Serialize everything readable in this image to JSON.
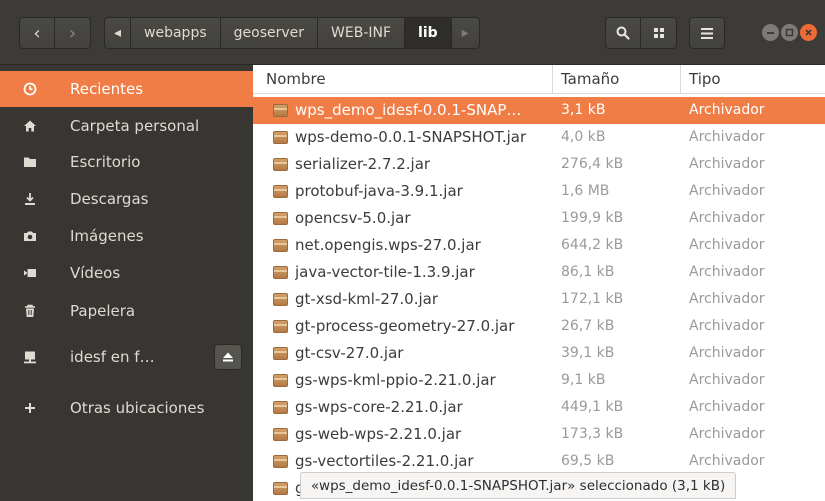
{
  "header": {
    "back_icon": "‹",
    "forward_icon": "›",
    "crumb_left_icon": "◂",
    "crumb_right_icon": "▸",
    "breadcrumbs": [
      "webapps",
      "geoserver",
      "WEB-INF",
      "lib"
    ],
    "active_crumb": "lib"
  },
  "sidebar": {
    "items": [
      {
        "label": "Recientes",
        "icon": "clock-icon"
      },
      {
        "label": "Carpeta personal",
        "icon": "home-icon"
      },
      {
        "label": "Escritorio",
        "icon": "folder-icon"
      },
      {
        "label": "Descargas",
        "icon": "download-icon"
      },
      {
        "label": "Imágenes",
        "icon": "camera-icon"
      },
      {
        "label": "Vídeos",
        "icon": "video-icon"
      },
      {
        "label": "Papelera",
        "icon": "trash-icon"
      },
      {
        "label": "idesf en f…",
        "icon": "network-drive-icon"
      },
      {
        "label": "Otras ubicaciones",
        "icon": "plus-icon"
      }
    ],
    "accent_color": "#ef7d45"
  },
  "list": {
    "columns": {
      "name": "Nombre",
      "size": "Tamaño",
      "type": "Tipo"
    },
    "rows": [
      {
        "name": "wps_demo_idesf-0.0.1-SNAP…",
        "size": "3,1 kB",
        "type": "Archivador"
      },
      {
        "name": "wps-demo-0.0.1-SNAPSHOT.jar",
        "size": "4,0 kB",
        "type": "Archivador"
      },
      {
        "name": "serializer-2.7.2.jar",
        "size": "276,4 kB",
        "type": "Archivador"
      },
      {
        "name": "protobuf-java-3.9.1.jar",
        "size": "1,6 MB",
        "type": "Archivador"
      },
      {
        "name": "opencsv-5.0.jar",
        "size": "199,9 kB",
        "type": "Archivador"
      },
      {
        "name": "net.opengis.wps-27.0.jar",
        "size": "644,2 kB",
        "type": "Archivador"
      },
      {
        "name": "java-vector-tile-1.3.9.jar",
        "size": "86,1 kB",
        "type": "Archivador"
      },
      {
        "name": "gt-xsd-kml-27.0.jar",
        "size": "172,1 kB",
        "type": "Archivador"
      },
      {
        "name": "gt-process-geometry-27.0.jar",
        "size": "26,7 kB",
        "type": "Archivador"
      },
      {
        "name": "gt-csv-27.0.jar",
        "size": "39,1 kB",
        "type": "Archivador"
      },
      {
        "name": "gs-wps-kml-ppio-2.21.0.jar",
        "size": "9,1 kB",
        "type": "Archivador"
      },
      {
        "name": "gs-wps-core-2.21.0.jar",
        "size": "449,1 kB",
        "type": "Archivador"
      },
      {
        "name": "gs-web-wps-2.21.0.jar",
        "size": "173,3 kB",
        "type": "Archivador"
      },
      {
        "name": "gs-vectortiles-2.21.0.jar",
        "size": "69,5 kB",
        "type": "Archivador"
      },
      {
        "name": "gs",
        "size": "",
        "type": ""
      }
    ]
  },
  "status": {
    "text": "«wps_demo_idesf-0.0.1-SNAPSHOT.jar» seleccionado (3,1 kB)"
  }
}
